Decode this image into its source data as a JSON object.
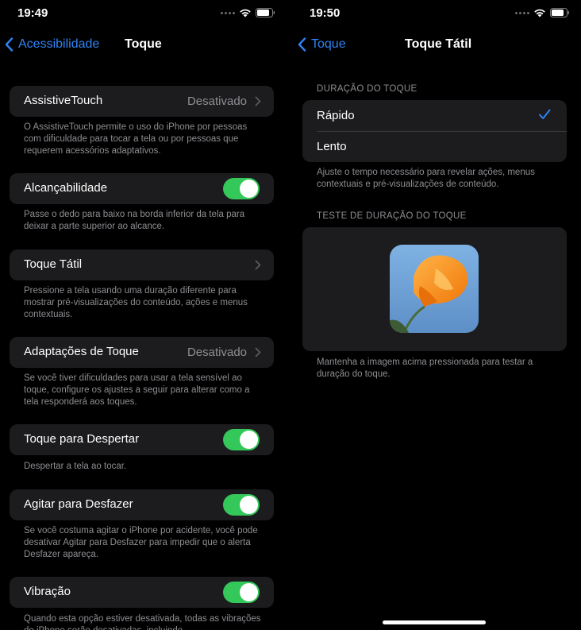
{
  "left_screen": {
    "time": "19:49",
    "nav": {
      "back_label": "Acessibilidade",
      "title": "Toque"
    },
    "rows": [
      {
        "label": "AssistiveTouch",
        "value": "Desativado",
        "footer": "O AssistiveTouch permite o uso do iPhone por pessoas com dificuldade para tocar a tela ou por pessoas que requerem acessórios adaptativos."
      },
      {
        "label": "Alcançabilidade",
        "toggle": true,
        "footer": "Passe o dedo para baixo na borda inferior da tela para deixar a parte superior ao alcance."
      },
      {
        "label": "Toque Tátil",
        "footer": "Pressione a tela usando uma duração diferente para mostrar pré-visualizações do conteúdo, ações e menus contextuais."
      },
      {
        "label": "Adaptações de Toque",
        "value": "Desativado",
        "footer": "Se você tiver dificuldades para usar a tela sensível ao toque, configure os ajustes a seguir para alterar como a tela responderá aos toques."
      },
      {
        "label": "Toque para Despertar",
        "toggle": true,
        "footer": "Despertar a tela ao tocar."
      },
      {
        "label": "Agitar para Desfazer",
        "toggle": true,
        "footer": "Se você costuma agitar o iPhone por acidente, você pode desativar Agitar para Desfazer para impedir que o alerta Desfazer apareça."
      },
      {
        "label": "Vibração",
        "toggle": true,
        "footer": "Quando esta opção estiver desativada, todas as vibrações do iPhone serão desativadas, incluindo"
      }
    ]
  },
  "right_screen": {
    "time": "19:50",
    "nav": {
      "back_label": "Toque",
      "title": "Toque Tátil"
    },
    "duration_header": "DURAÇÃO DO TOQUE",
    "options": [
      {
        "label": "Rápido",
        "selected": true
      },
      {
        "label": "Lento",
        "selected": false
      }
    ],
    "duration_footer": "Ajuste o tempo necessário para revelar ações, menus contextuais e pré-visualizações de conteúdo.",
    "test_header": "TESTE DE DURAÇÃO DO TOQUE",
    "test_footer": "Mantenha a imagem acima pressionada para testar a duração do toque."
  },
  "colors": {
    "accent": "#2f83f5",
    "toggle_on": "#34c759",
    "cell_bg": "#1c1c1e",
    "secondary_text": "#8e8e93"
  },
  "icons": [
    "cellular-dots-icon",
    "wifi-icon",
    "battery-icon",
    "chevron-left-icon",
    "chevron-right-icon",
    "checkmark-icon"
  ]
}
